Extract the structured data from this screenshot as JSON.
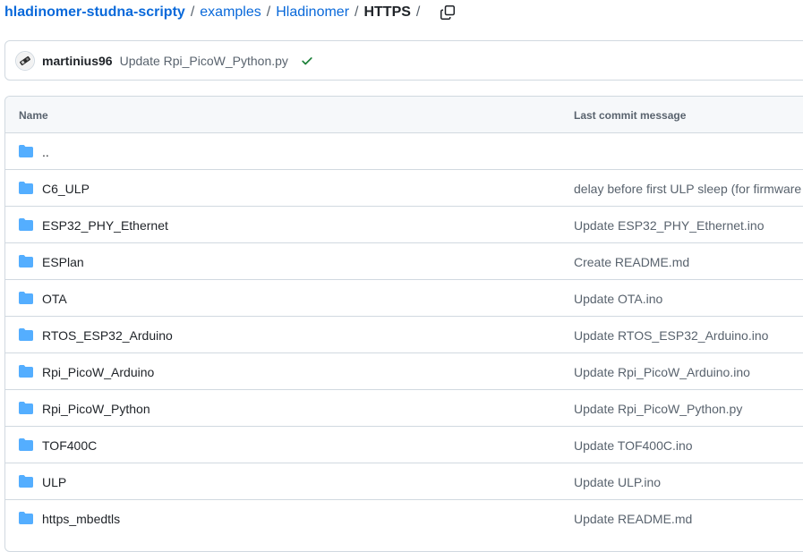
{
  "breadcrumb": {
    "repo": "hladinomer-studna-scripty",
    "separator": "/",
    "path": [
      "examples",
      "Hladinomer"
    ],
    "current": "HTTPS",
    "trailing_separator": "/",
    "copy_icon": "copy-icon"
  },
  "latest_commit": {
    "avatar_icon": "avatar",
    "author": "martinius96",
    "message": "Update Rpi_PicoW_Python.py",
    "status_icon": "check-icon",
    "status_color": "#1a7f37"
  },
  "table": {
    "headers": {
      "name": "Name",
      "last_commit_message": "Last commit message"
    },
    "folder_color": "#54aeff",
    "rows": [
      {
        "name": "..",
        "message": ""
      },
      {
        "name": "C6_ULP",
        "message": "delay before first ULP sleep (for firmware"
      },
      {
        "name": "ESP32_PHY_Ethernet",
        "message": "Update ESP32_PHY_Ethernet.ino"
      },
      {
        "name": "ESPlan",
        "message": "Create README.md"
      },
      {
        "name": "OTA",
        "message": "Update OTA.ino"
      },
      {
        "name": "RTOS_ESP32_Arduino",
        "message": "Update RTOS_ESP32_Arduino.ino"
      },
      {
        "name": "Rpi_PicoW_Arduino",
        "message": "Update Rpi_PicoW_Arduino.ino"
      },
      {
        "name": "Rpi_PicoW_Python",
        "message": "Update Rpi_PicoW_Python.py"
      },
      {
        "name": "TOF400C",
        "message": "Update TOF400C.ino"
      },
      {
        "name": "ULP",
        "message": "Update ULP.ino"
      },
      {
        "name": "https_mbedtls",
        "message": "Update README.md"
      }
    ]
  }
}
